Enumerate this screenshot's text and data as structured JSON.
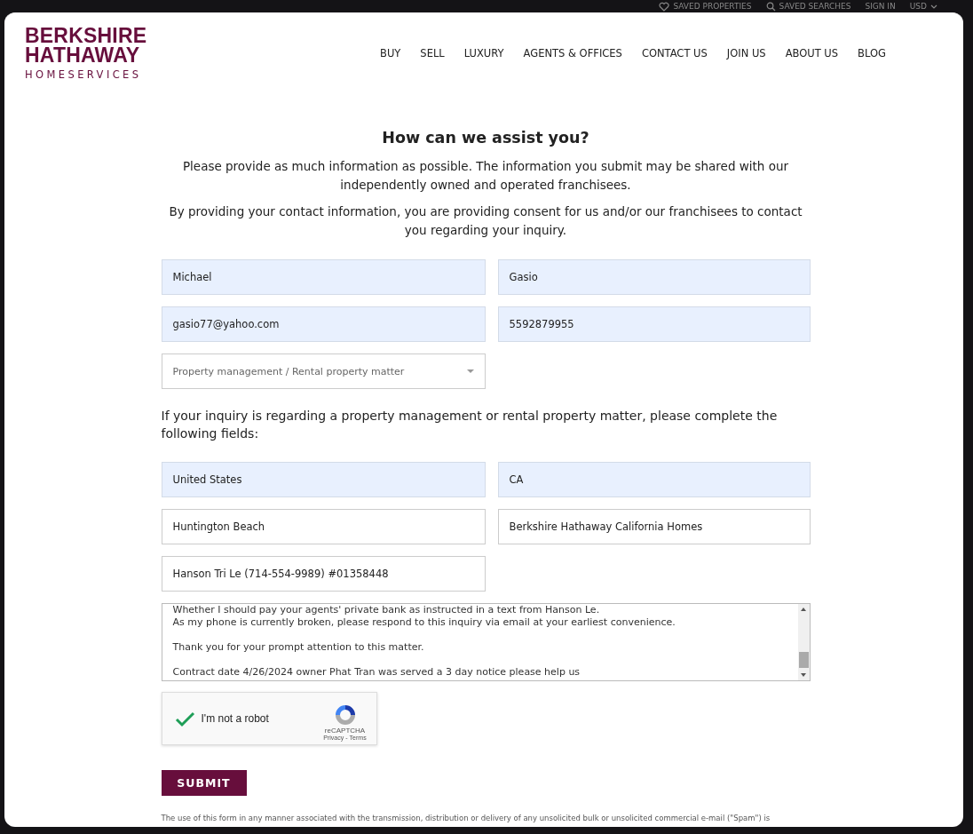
{
  "utility_bar": [
    {
      "label": "SAVED PROPERTIES",
      "kind": "saved"
    },
    {
      "label": "SAVED SEARCHES",
      "kind": "search"
    },
    {
      "label": "SIGN IN",
      "kind": "plain"
    },
    {
      "label": "USD",
      "kind": "currency"
    }
  ],
  "logo": {
    "line_1": "BERKSHIRE",
    "line_2": "HATHAWAY",
    "line_3": "HOMESERVICES"
  },
  "nav": [
    "BUY",
    "SELL",
    "LUXURY",
    "AGENTS & OFFICES",
    "CONTACT US",
    "JOIN US",
    "ABOUT US",
    "BLOG"
  ],
  "form": {
    "title": "How can we assist you?",
    "intro": [
      "Please provide as much information as possible. The information you submit may be shared with our independently owned and operated franchisees.",
      "By providing your contact information, you are providing consent for us and/or our franchisees to contact you regarding your inquiry."
    ],
    "contact_fields": [
      {
        "value": "Michael",
        "autofilled": true
      },
      {
        "value": "Gasio",
        "autofilled": true
      },
      {
        "value": "gasio77@yahoo.com",
        "autofilled": true
      },
      {
        "value": "5592879955",
        "autofilled": true
      }
    ],
    "inquiry_select": {
      "value": "Property management / Rental property matter"
    },
    "rental_note": "If your inquiry is regarding a property management or rental property matter, please complete the following fields:",
    "rental_fields": [
      {
        "value": "United States",
        "autofilled": true
      },
      {
        "value": "CA",
        "autofilled": true
      },
      {
        "value": "Huntington Beach",
        "autofilled": false
      },
      {
        "value": "Berkshire Hathaway California Homes",
        "autofilled": false
      },
      {
        "value": "Hanson Tri Le (714-554-9989) #01358448",
        "autofilled": false
      }
    ],
    "message_paragraphs": [
      [
        "Whether I should pay your agents' private bank as instructed in a text from Hanson Le.",
        "As my phone is currently broken, please respond to this inquiry via email at your earliest convenience."
      ],
      [
        "Thank you for your prompt attention to this matter."
      ],
      [
        "Contract date 4/26/2024 owner Phat Tran was served a 3 day notice please help us"
      ]
    ],
    "captcha": {
      "label": "I'm not a robot",
      "checked": true,
      "brand": "reCAPTCHA",
      "privacy": "Privacy",
      "separator": "-",
      "terms": "Terms"
    },
    "submit": "SUBMIT",
    "disclaimer": "The use of this form in any manner associated with the transmission, distribution or delivery of any unsolicited bulk or unsolicited commercial e-mail (\"Spam\") is"
  }
}
